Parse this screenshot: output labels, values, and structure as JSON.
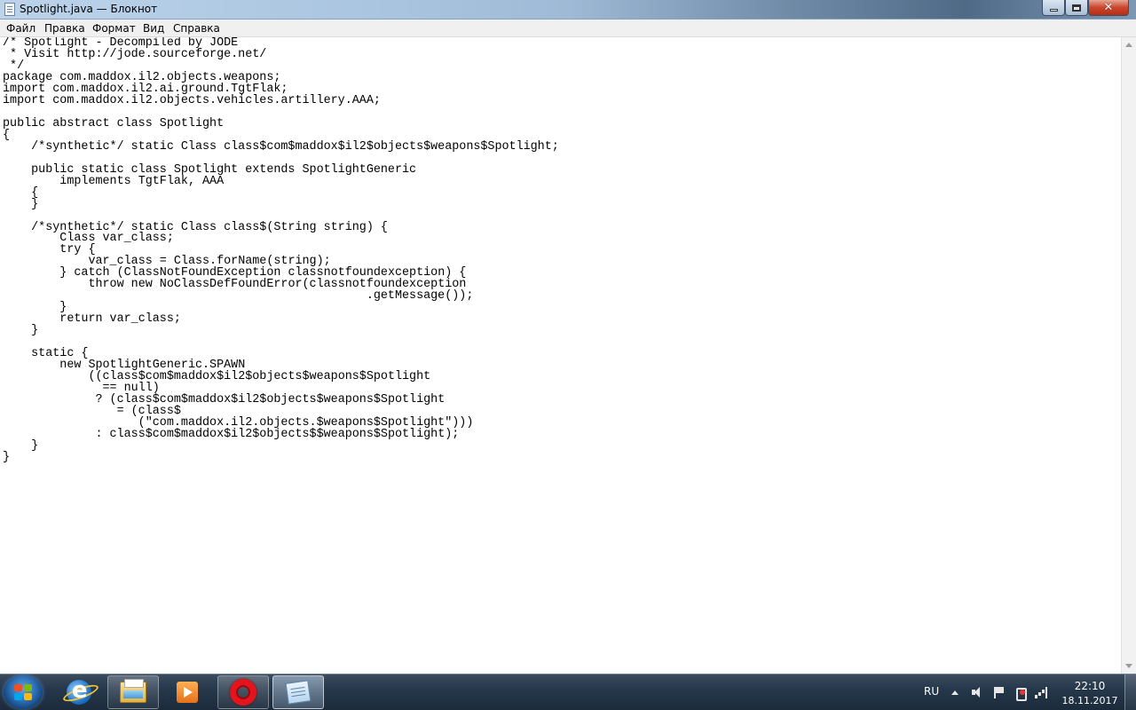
{
  "window": {
    "title": "Spotlight.java — Блокнот",
    "minimize_icon": "minimize-icon",
    "maximize_icon": "restore-icon",
    "close_icon": "close-icon",
    "close_symbol": "✕"
  },
  "menu": {
    "items": [
      {
        "label": "Файл"
      },
      {
        "label": "Правка"
      },
      {
        "label": "Формат"
      },
      {
        "label": "Вид"
      },
      {
        "label": "Справка"
      }
    ]
  },
  "editor": {
    "text": "/* Spotlight - Decompiled by JODE\n * Visit http://jode.sourceforge.net/\n */\npackage com.maddox.il2.objects.weapons;\nimport com.maddox.il2.ai.ground.TgtFlak;\nimport com.maddox.il2.objects.vehicles.artillery.AAA;\n\npublic abstract class Spotlight\n{\n    /*synthetic*/ static Class class$com$maddox$il2$objects$weapons$Spotlight;\n    \n    public static class Spotlight extends SpotlightGeneric\n\timplements TgtFlak, AAA\n    {\n    }\n    \n    /*synthetic*/ static Class class$(String string) {\n\tClass var_class;\n\ttry {\n\t    var_class = Class.forName(string);\n\t} catch (ClassNotFoundException classnotfoundexception) {\n\t    throw new NoClassDefFoundError(classnotfoundexception\n\t\t\t\t\t\t   .getMessage());\n\t}\n\treturn var_class;\n    }\n    \n    static {\n\tnew SpotlightGeneric.SPAWN\n\t    ((class$com$maddox$il2$objects$weapons$Spotlight\n\t      == null)\n\t     ? (class$com$maddox$il2$objects$weapons$Spotlight\n\t\t= (class$\n\t\t   (\"com.maddox.il2.objects.$weapons$Spotlight\")))\n\t     : class$com$maddox$il2$objects$$weapons$Spotlight);\n    }\n}"
  },
  "taskbar": {
    "start_icon": "windows-start-icon",
    "apps": [
      {
        "name": "Internet Explorer",
        "icon": "ie-icon",
        "state": "pinned"
      },
      {
        "name": "Explorer",
        "icon": "folder-icon",
        "state": "open"
      },
      {
        "name": "Media Player",
        "icon": "media-player-icon",
        "state": "pinned"
      },
      {
        "name": "Opera",
        "icon": "opera-icon",
        "state": "open"
      },
      {
        "name": "Notepad",
        "icon": "notepad-icon",
        "state": "active"
      }
    ],
    "tray": {
      "language": "RU",
      "time": "22:10",
      "date": "18.11.2017"
    }
  },
  "colors": {
    "editor_background": "#ffffff",
    "menu_background": "#f0f0f0",
    "taskbar": "#1c2b3b",
    "close_button": "#c9462c"
  }
}
